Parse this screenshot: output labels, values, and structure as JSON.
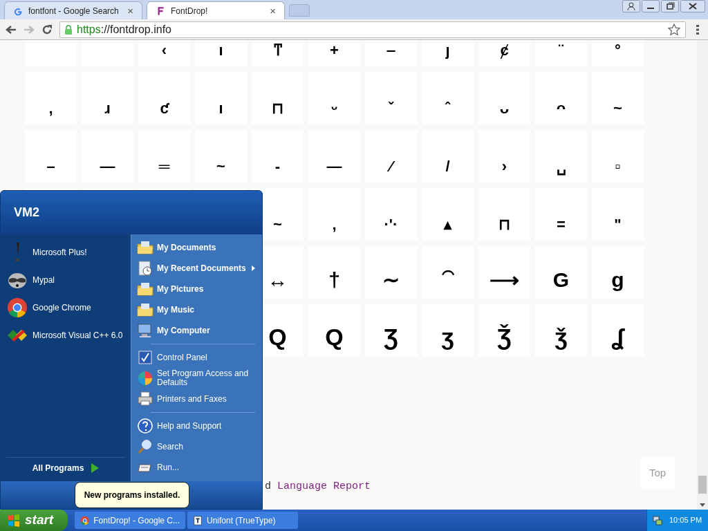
{
  "browser": {
    "tabs": [
      {
        "title": "fontfont - Google Search",
        "selected": false,
        "close": "×"
      },
      {
        "title": "FontDrop!",
        "selected": true,
        "close": "×"
      }
    ],
    "url": {
      "scheme": "https",
      "rest": "://fontdrop.info"
    }
  },
  "glyph_grid": {
    "rows": [
      {
        "kind": "marks",
        "cells": [
          null,
          null,
          "‹",
          "ı",
          "ͳ",
          "+",
          "‒",
          "ȷ",
          "ȼ",
          "¨",
          "°"
        ]
      },
      {
        "kind": "marks",
        "cells": [
          ",",
          "ɹ",
          "ƈ",
          "ı",
          "⊓",
          "ᵕ",
          "ˇ",
          "ˆ",
          "ᴗ",
          "ᴖ",
          "~"
        ]
      },
      {
        "kind": "marks",
        "cells": [
          "–",
          "—",
          "═",
          "~",
          "-",
          "—",
          "⁄",
          "/",
          "›",
          "␣",
          "▫"
        ]
      },
      {
        "kind": "marks",
        "cells": [
          null,
          null,
          null,
          null,
          "~",
          ",",
          "·'·",
          "▴",
          "⊓",
          "=",
          "\""
        ]
      },
      {
        "kind": "mixed",
        "cells": [
          null,
          null,
          null,
          null,
          "↔",
          "†",
          "∼",
          "⁀",
          "⟶",
          "G",
          "g"
        ]
      },
      {
        "kind": "letters",
        "cells": [
          null,
          null,
          null,
          null,
          "Q",
          "Q",
          "Ʒ",
          "ʒ",
          "Ǯ",
          "ǯ",
          "ʆ"
        ]
      }
    ]
  },
  "footer_line": {
    "prefix": "d",
    "link": "Language Report"
  },
  "top_button": "Top",
  "start_menu": {
    "user": "VM2",
    "pinned": [
      {
        "label": "Microsoft Plus!"
      },
      {
        "label": "Mypal"
      },
      {
        "label": "Google Chrome"
      },
      {
        "label": "Microsoft Visual C++ 6.0"
      }
    ],
    "places": [
      {
        "kind": "folder",
        "label": "My Documents",
        "submenu": false
      },
      {
        "kind": "folder",
        "label": "My Recent Documents",
        "submenu": true
      },
      {
        "kind": "folder",
        "label": "My Pictures",
        "submenu": false
      },
      {
        "kind": "folder",
        "label": "My Music",
        "submenu": false
      },
      {
        "kind": "folder",
        "label": "My Computer",
        "submenu": false
      },
      {
        "kind": "separator"
      },
      {
        "kind": "setting",
        "label": "Control Panel",
        "submenu": false
      },
      {
        "kind": "setting",
        "label": "Set Program Access and Defaults",
        "submenu": false
      },
      {
        "kind": "setting",
        "label": "Printers and Faxes",
        "submenu": false
      },
      {
        "kind": "separator"
      },
      {
        "kind": "setting",
        "label": "Help and Support",
        "submenu": false
      },
      {
        "kind": "setting",
        "label": "Search",
        "submenu": false
      },
      {
        "kind": "setting",
        "label": "Run...",
        "submenu": false
      }
    ],
    "all_programs": "All Programs",
    "balloon": "New programs installed."
  },
  "taskbar": {
    "start": "start",
    "tasks": [
      {
        "label": "FontDrop! - Google C..."
      },
      {
        "label": "Unifont (TrueType)"
      }
    ],
    "clock": "10:05 PM"
  }
}
